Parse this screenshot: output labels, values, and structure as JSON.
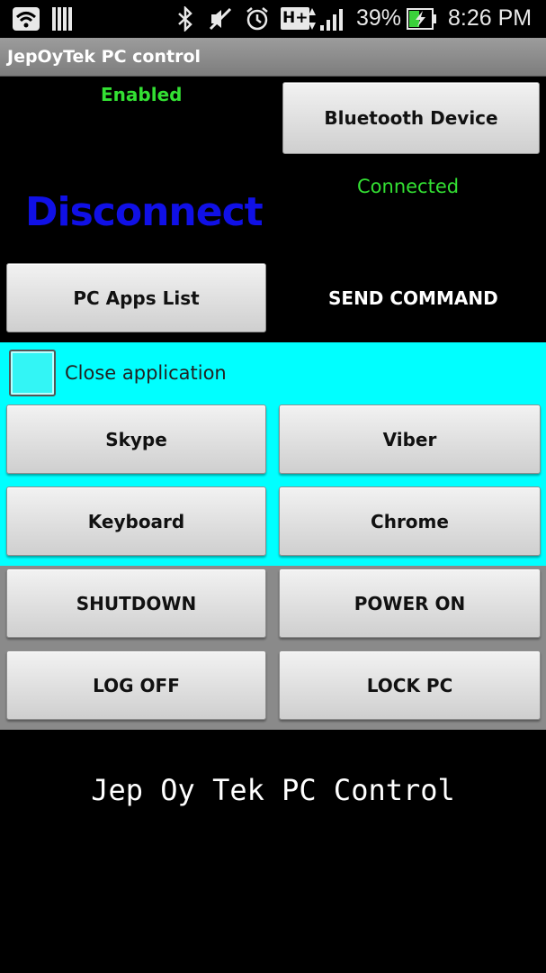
{
  "status_bar": {
    "battery": "39%",
    "time": "8:26 PM",
    "network": "H+"
  },
  "app": {
    "title": "JepOyTek PC control"
  },
  "status": {
    "enabled": "Enabled",
    "connected": "Connected",
    "disconnect": "Disconnect"
  },
  "buttons": {
    "bluetooth": "Bluetooth Device",
    "pc_apps": "PC Apps List",
    "skype": "Skype",
    "viber": "Viber",
    "keyboard": "Keyboard",
    "chrome": "Chrome",
    "shutdown": "SHUTDOWN",
    "power_on": "POWER ON",
    "log_off": "LOG OFF",
    "lock_pc": "LOCK PC"
  },
  "labels": {
    "send_command": "SEND COMMAND",
    "close_application": "Close application",
    "footer": "Jep Oy Tek PC Control"
  },
  "colors": {
    "enabled_green": "#33e033",
    "disconnect_blue": "#1010e6",
    "cyan_panel": "#00ffff",
    "grey_panel": "#8a8a8a"
  }
}
